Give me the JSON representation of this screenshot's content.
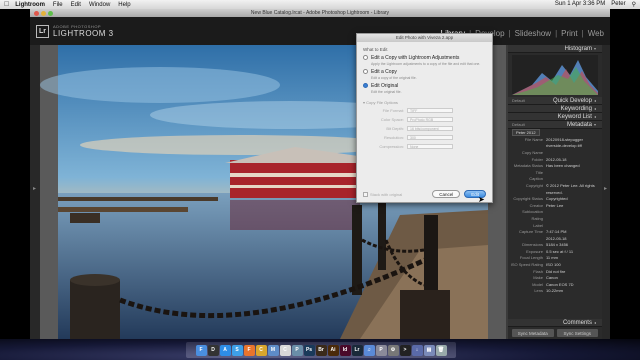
{
  "menubar": {
    "apple": "",
    "app": "Lightroom",
    "items": [
      "File",
      "Edit",
      "Window",
      "Help"
    ],
    "clock": "Sun 1 Apr 3:36 PM",
    "user": "Peter"
  },
  "window": {
    "title": "New Blue Catalog.lrcat - Adobe Photoshop Lightroom - Library"
  },
  "identity": {
    "logo": "Lr",
    "line1": "ADOBE PHOTOSHOP",
    "line2": "LIGHTROOM 3"
  },
  "modules": [
    {
      "label": "Library",
      "active": true
    },
    {
      "label": "Develop"
    },
    {
      "label": "Slideshow"
    },
    {
      "label": "Print"
    },
    {
      "label": "Web"
    }
  ],
  "right_panel": {
    "histogram": "Histogram",
    "quick_develop_preset": "Default",
    "quick_develop": "Quick Develop",
    "keywording": "Keywording",
    "keyword_list": "Keyword List",
    "metadata_preset": "Default",
    "metadata": "Metadata",
    "preset_value": "Peter 2012",
    "meta_rows": [
      {
        "k": "File Name",
        "v": "20120918-stepugger"
      },
      {
        "k": "",
        "v": "riverside-develop.tiff"
      },
      {
        "k": "Copy Name",
        "v": ""
      },
      {
        "k": "Folder",
        "v": "2012-05-18"
      },
      {
        "k": "Metadata Status",
        "v": "Has been changed"
      },
      {
        "k": "Title",
        "v": ""
      },
      {
        "k": "Caption",
        "v": ""
      },
      {
        "k": "Copyright",
        "v": "© 2012 Peter Lee. All rights"
      },
      {
        "k": "",
        "v": "reserved."
      },
      {
        "k": "Copyright Status",
        "v": "Copyrighted"
      },
      {
        "k": "Creator",
        "v": "Peter Lee"
      },
      {
        "k": "Sublocation",
        "v": ""
      },
      {
        "k": "Rating",
        "v": ""
      },
      {
        "k": "Label",
        "v": ""
      },
      {
        "k": "Capture Time",
        "v": "7:47:14 PM"
      },
      {
        "k": "",
        "v": "2012-05-18"
      },
      {
        "k": "Dimensions",
        "v": "5184 x 3456"
      },
      {
        "k": "Exposure",
        "v": "0.5 sec at f / 11"
      },
      {
        "k": "Focal Length",
        "v": "11 mm"
      },
      {
        "k": "ISO Speed Rating",
        "v": "ISO 100"
      },
      {
        "k": "Flash",
        "v": "Did not fire"
      },
      {
        "k": "Make",
        "v": "Canon"
      },
      {
        "k": "Model",
        "v": "Canon EOS 7D"
      },
      {
        "k": "Lens",
        "v": "10-22mm"
      }
    ],
    "comments": "Comments",
    "sync_metadata": "Sync Metadata",
    "sync_settings": "Sync Settings"
  },
  "dialog": {
    "title": "Edit Photo with Viveza 2.app",
    "question": "What to Edit",
    "options": [
      {
        "title": "Edit a Copy with Lightroom Adjustments",
        "desc": "Apply the Lightroom adjustments to a copy of the file and edit that one.",
        "selected": false
      },
      {
        "title": "Edit a Copy",
        "desc": "Edit a copy of the original file.",
        "selected": false
      },
      {
        "title": "Edit Original",
        "desc": "Edit the original file.",
        "selected": true
      }
    ],
    "copy_file_options": "Copy File Options",
    "fields": [
      {
        "label": "File Format:",
        "value": "TIFF"
      },
      {
        "label": "Color Space:",
        "value": "ProPhoto RGB"
      },
      {
        "label": "Bit Depth:",
        "value": "16 bits/component"
      },
      {
        "label": "Resolution:",
        "value": "300"
      },
      {
        "label": "Compression:",
        "value": "None"
      }
    ],
    "stack": "Stack with original",
    "cancel": "Cancel",
    "edit": "Edit"
  },
  "dock_icons": [
    {
      "name": "finder-icon",
      "label": "F",
      "color": "#4a8fe0"
    },
    {
      "name": "dashboard-icon",
      "label": "D",
      "color": "#333"
    },
    {
      "name": "app-store-icon",
      "label": "A",
      "color": "#2d8de6"
    },
    {
      "name": "safari-icon",
      "label": "S",
      "color": "#3ea0e8"
    },
    {
      "name": "firefox-icon",
      "label": "F",
      "color": "#e8742d"
    },
    {
      "name": "chrome-icon",
      "label": "C",
      "color": "#d9a62e"
    },
    {
      "name": "mail-icon",
      "label": "M",
      "color": "#5e8cc8"
    },
    {
      "name": "ical-icon",
      "label": "C",
      "color": "#d8d8d8"
    },
    {
      "name": "iphoto-icon",
      "label": "P",
      "color": "#6a8ea8"
    },
    {
      "name": "photoshop-icon",
      "label": "Ps",
      "color": "#1a3a5a"
    },
    {
      "name": "bridge-icon",
      "label": "Br",
      "color": "#3a2a1a"
    },
    {
      "name": "illustrator-icon",
      "label": "Ai",
      "color": "#4a2a0a"
    },
    {
      "name": "indesign-icon",
      "label": "Id",
      "color": "#4a0a2a"
    },
    {
      "name": "lightroom-icon",
      "label": "Lr",
      "color": "#1a2a3a"
    },
    {
      "name": "itunes-icon",
      "label": "♫",
      "color": "#5a8ad8"
    },
    {
      "name": "preview-icon",
      "label": "P",
      "color": "#8a8a9a"
    },
    {
      "name": "system-prefs-icon",
      "label": "⚙",
      "color": "#777"
    },
    {
      "name": "terminal-icon",
      "label": ">",
      "color": "#222"
    },
    {
      "name": "downloads-icon",
      "label": "↓",
      "color": "#5a6aa8"
    },
    {
      "name": "documents-icon",
      "label": "▤",
      "color": "#7a8ab8"
    },
    {
      "name": "trash-icon",
      "label": "🗑",
      "color": "#9aa"
    }
  ],
  "colors": {
    "accent_blue": "#3d8de0",
    "lr_bg": "#3b3b3b",
    "panel_bg": "#2b2b2b"
  }
}
